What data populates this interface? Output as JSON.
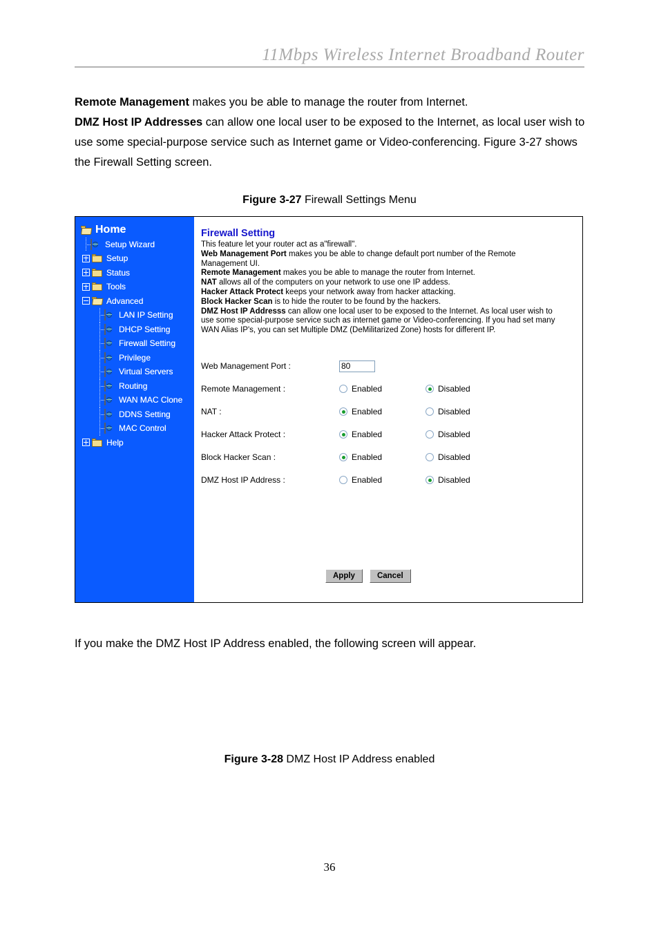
{
  "document": {
    "header_title": "11Mbps  Wireless  Internet  Broadband  Router",
    "page_number": "36",
    "intro_line1_bold": "Remote Management",
    "intro_line1_rest": " makes you be able to manage the router from Internet.",
    "intro_line2_bold": "DMZ Host IP Addresses",
    "intro_line2_rest": " can allow one local user to be exposed to the Internet, as local user wish to use some special-purpose service such as Internet game or Video-conferencing. Figure 3-27 shows the Firewall Setting screen.",
    "caption_327_label": "Figure 3-27",
    "caption_327_text": " Firewall Settings Menu",
    "after_figure_text": "If you make the DMZ Host IP Address enabled, the following screen will appear.",
    "caption_328_label": "Figure 3-28",
    "caption_328_text": " DMZ Host IP Address enabled"
  },
  "router_ui": {
    "sidebar": {
      "background_color": "#0a5bff",
      "root": {
        "label": "Home",
        "icon": "open-folder-icon"
      },
      "items": [
        {
          "label": "Setup Wizard",
          "icon": "page-globe-icon",
          "level": 1,
          "expander": "none"
        },
        {
          "label": "Setup",
          "icon": "closed-folder-icon",
          "level": 1,
          "expander": "plus"
        },
        {
          "label": "Status",
          "icon": "closed-folder-icon",
          "level": 1,
          "expander": "plus"
        },
        {
          "label": "Tools",
          "icon": "closed-folder-icon",
          "level": 1,
          "expander": "plus"
        },
        {
          "label": "Advanced",
          "icon": "open-folder-icon",
          "level": 1,
          "expander": "minus"
        },
        {
          "label": "LAN IP Setting",
          "icon": "page-globe-icon",
          "level": 2,
          "expander": "none"
        },
        {
          "label": "DHCP Setting",
          "icon": "page-globe-icon",
          "level": 2,
          "expander": "none"
        },
        {
          "label": "Firewall Setting",
          "icon": "page-globe-icon",
          "level": 2,
          "expander": "none"
        },
        {
          "label": "Privilege",
          "icon": "page-globe-icon",
          "level": 2,
          "expander": "none"
        },
        {
          "label": "Virtual Servers",
          "icon": "page-globe-icon",
          "level": 2,
          "expander": "none"
        },
        {
          "label": "Routing",
          "icon": "page-globe-icon",
          "level": 2,
          "expander": "none"
        },
        {
          "label": "WAN MAC Clone",
          "icon": "page-globe-icon",
          "level": 2,
          "expander": "none"
        },
        {
          "label": "DDNS Setting",
          "icon": "page-globe-icon",
          "level": 2,
          "expander": "none"
        },
        {
          "label": "MAC Control",
          "icon": "page-globe-icon",
          "level": 2,
          "expander": "none"
        },
        {
          "label": "Help",
          "icon": "closed-folder-icon",
          "level": 1,
          "expander": "plus"
        }
      ]
    },
    "panel": {
      "title": "Firewall Setting",
      "title_color": "#1616cc",
      "desc_intro": "This feature let your router act as a\"firewall\".",
      "desc_items": [
        {
          "bold": "Web Management Port",
          "rest": " makes you be able to change default port number of the Remote Management UI."
        },
        {
          "bold": "Remote Management",
          "rest": " makes you be able to manage the router from Internet."
        },
        {
          "bold": "NAT",
          "rest": " allows all of the computers on your network to use one IP addess."
        },
        {
          "bold": "Hacker Attack Protect",
          "rest": " keeps your network away from hacker attacking."
        },
        {
          "bold": "Block Hacker Scan",
          "rest": " is to hide the router to be found by the hackers."
        },
        {
          "bold": "DMZ Host IP Addresss",
          "rest": " can allow one local user to be exposed to the Internet. As local user wish to use some special-purpose service such as internet game or Video-conferencing.  If you had set many WAN Alias IP's, you can set Multiple DMZ (DeMilitarized Zone) hosts for different IP."
        }
      ],
      "form": {
        "port_label": "Web Management Port :",
        "port_value": "80",
        "rows": [
          {
            "label": "Remote Management :",
            "enabled_label": "Enabled",
            "disabled_label": "Disabled",
            "selected": "Disabled"
          },
          {
            "label": "NAT :",
            "enabled_label": "Enabled",
            "disabled_label": "Disabled",
            "selected": "Enabled"
          },
          {
            "label": "Hacker Attack Protect :",
            "enabled_label": "Enabled",
            "disabled_label": "Disabled",
            "selected": "Enabled"
          },
          {
            "label": "Block Hacker Scan :",
            "enabled_label": "Enabled",
            "disabled_label": "Disabled",
            "selected": "Enabled"
          },
          {
            "label": "DMZ Host IP Address :",
            "enabled_label": "Enabled",
            "disabled_label": "Disabled",
            "selected": "Disabled"
          }
        ],
        "apply_label": "Apply",
        "cancel_label": "Cancel"
      }
    }
  }
}
